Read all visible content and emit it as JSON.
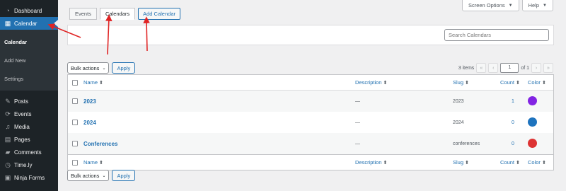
{
  "sidebar": {
    "items": [
      {
        "label": "Dashboard",
        "icon": "dashboard-icon",
        "glyph": "◔"
      },
      {
        "label": "Calendar",
        "icon": "calendar-icon",
        "glyph": "▦"
      }
    ],
    "submenu": [
      {
        "label": "Calendar"
      },
      {
        "label": "Add New"
      },
      {
        "label": "Settings"
      }
    ],
    "lower_items": [
      {
        "label": "Posts",
        "icon": "pushpin-icon",
        "glyph": "✎"
      },
      {
        "label": "Events",
        "icon": "events-icon",
        "glyph": "⟳"
      },
      {
        "label": "Media",
        "icon": "media-icon",
        "glyph": "♫"
      },
      {
        "label": "Pages",
        "icon": "pages-icon",
        "glyph": "▤"
      },
      {
        "label": "Comments",
        "icon": "comments-icon",
        "glyph": "▰"
      },
      {
        "label": "Time.ly",
        "icon": "timely-icon",
        "glyph": "◷"
      },
      {
        "label": "Ninja Forms",
        "icon": "ninja-forms-icon",
        "glyph": "▣"
      }
    ]
  },
  "screen_meta": {
    "screen_options": "Screen Options",
    "help": "Help",
    "caret": "▼"
  },
  "tabs": {
    "events": "Events",
    "calendars": "Calendars",
    "add_calendar": "Add Calendar"
  },
  "search": {
    "placeholder": "Search Calendars"
  },
  "bulk": {
    "select_label": "Bulk actions",
    "caret": "⌄",
    "apply": "Apply"
  },
  "pagination": {
    "items": "3 items",
    "first": "«",
    "prev": "‹",
    "current": "1",
    "of": "of 1",
    "next": "›",
    "last": "»"
  },
  "table": {
    "columns": {
      "name": "Name",
      "description": "Description",
      "slug": "Slug",
      "count": "Count",
      "color": "Color",
      "sort_glyph": "⬍"
    },
    "rows": [
      {
        "name": "2023",
        "description": "—",
        "slug": "2023",
        "count": "1",
        "color": "#8224e3"
      },
      {
        "name": "2024",
        "description": "—",
        "slug": "2024",
        "count": "0",
        "color": "#1e73be"
      },
      {
        "name": "Conferences",
        "description": "—",
        "slug": "conferences",
        "count": "0",
        "color": "#dd3333"
      }
    ]
  },
  "colors": {
    "accent": "#2271b1",
    "sidebar_bg": "#1d2327",
    "annotation_arrow": "#e02424"
  }
}
